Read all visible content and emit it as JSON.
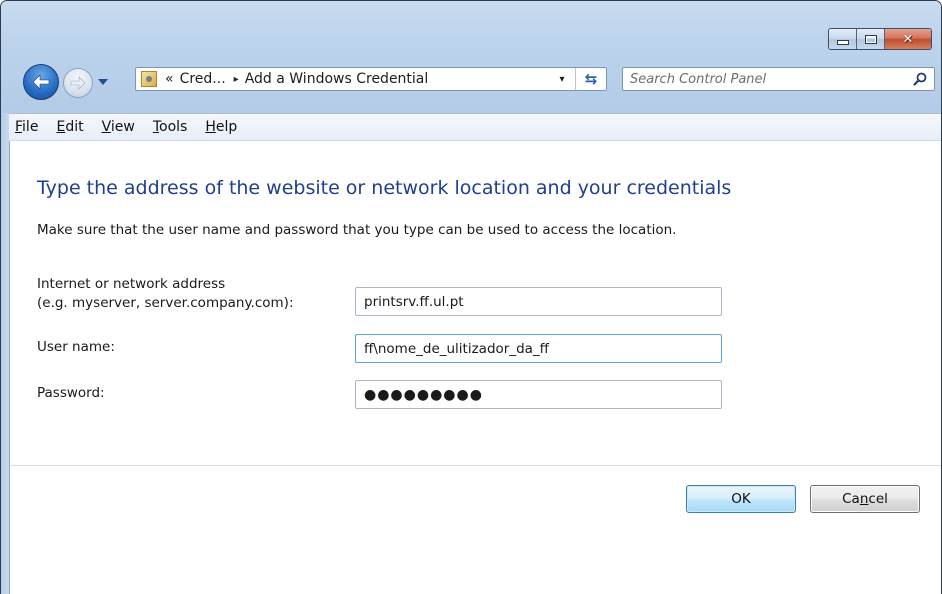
{
  "window": {
    "caption_buttons": {
      "minimize_icon": "minimize-icon",
      "maximize_icon": "maximize-icon",
      "close_icon": "close-icon",
      "close_glyph": "✕"
    }
  },
  "navigation": {
    "back_icon": "back-arrow-icon",
    "forward_icon": "forward-arrow-icon",
    "address": {
      "overflow_chevron": "«",
      "crumb": "Cred...",
      "separator": "▸",
      "current": "Add a Windows Credential",
      "dropdown_glyph": "▾",
      "refresh_glyph": "⇆"
    },
    "search": {
      "placeholder": "Search Control Panel"
    }
  },
  "menu": {
    "items": [
      {
        "accel": "F",
        "rest": "ile"
      },
      {
        "accel": "E",
        "rest": "dit"
      },
      {
        "accel": "V",
        "rest": "iew"
      },
      {
        "accel": "T",
        "rest": "ools"
      },
      {
        "accel": "H",
        "rest": "elp"
      }
    ]
  },
  "content": {
    "title": "Type the address of the website or network location and your credentials",
    "subtitle": "Make sure that the user name and password that you type can be used to access the location.",
    "fields": {
      "address": {
        "label_line1": "Internet or network address",
        "label_line2": "(e.g. myserver, server.company.com):",
        "value": "printsrv.ff.ul.pt"
      },
      "username": {
        "label": "User name:",
        "value": "ff\\nome_de_ulitizador_da_ff"
      },
      "password": {
        "label": "Password:",
        "value": "●●●●●●●●●"
      }
    },
    "buttons": {
      "ok": "OK",
      "cancel_pre": "Ca",
      "cancel_accel": "n",
      "cancel_post": "cel"
    }
  },
  "colors": {
    "title_blue": "#1f3f8f",
    "ok_border": "#3c7fb1",
    "frame": "#bcd3ec"
  }
}
